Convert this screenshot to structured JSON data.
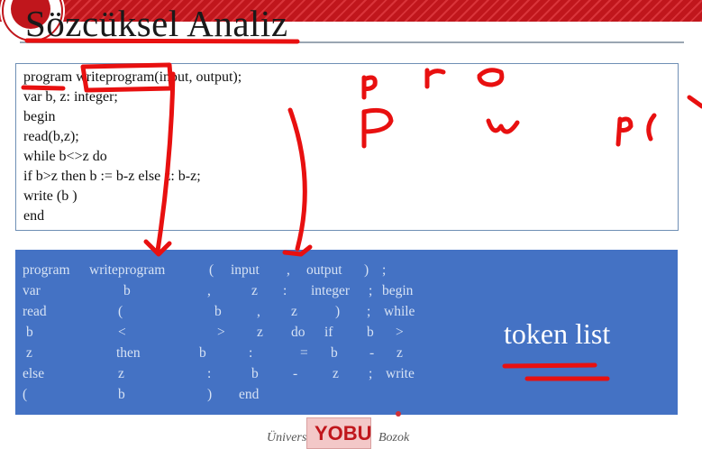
{
  "slide": {
    "title": "Sözcüksel Analiz",
    "code_lines": [
      "program writeprogram(input, output);",
      "var b, z: integer;",
      "begin",
      "read(b,z);",
      "while b<>z do",
      "if b>z then b := b-z else z: b-z;",
      "write (b )",
      "end"
    ],
    "token_rows": [
      [
        "program",
        "writeprogram",
        "(",
        "input",
        ",",
        "output",
        ")",
        ";"
      ],
      [
        "var",
        "b",
        ",",
        "z",
        ":",
        "integer",
        ";",
        "begin"
      ],
      [
        "read",
        "(",
        "b",
        ",",
        "z",
        ")",
        ";",
        "while"
      ],
      [
        "b",
        "<",
        ">",
        "z",
        "do",
        "if",
        "b",
        ">"
      ],
      [
        "z",
        "then",
        "b",
        ":",
        "=",
        "b",
        "-",
        "z"
      ],
      [
        "else",
        "z",
        ":",
        "b",
        "-",
        "z",
        ";",
        "write"
      ],
      [
        "(",
        "b",
        ")",
        "end"
      ]
    ],
    "token_label": "token list",
    "footer_logo": "YOBU",
    "footer_left_script": "Üniversite",
    "footer_right_script": "Bozok",
    "colors": {
      "header_red": "#c0161c",
      "token_box_blue": "#4472c4",
      "ink_red": "#e81010"
    }
  }
}
